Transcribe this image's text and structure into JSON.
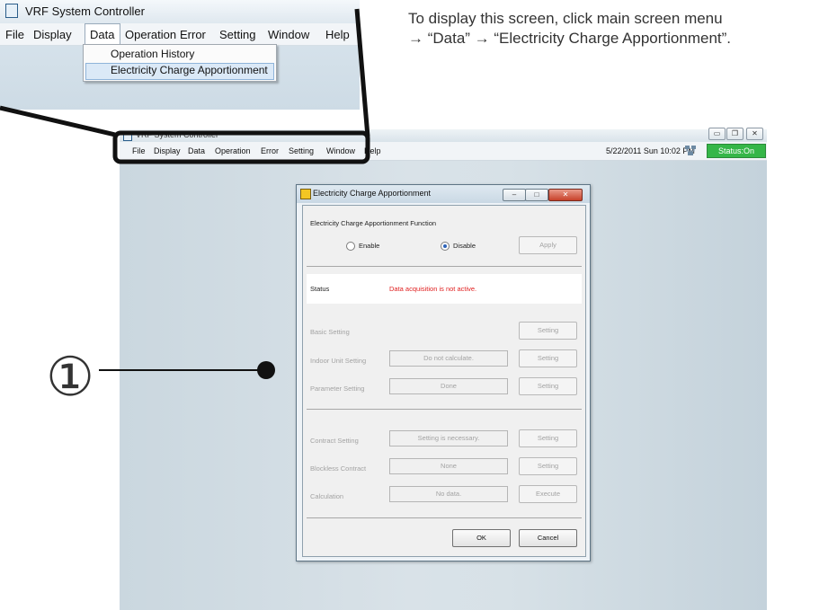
{
  "inset": {
    "title": "VRF System Controller",
    "menu": [
      "File",
      "Display",
      "Data",
      "Operation",
      "Error",
      "Setting",
      "Window",
      "Help"
    ],
    "dropdown": [
      "Operation History",
      "Electricity Charge Apportionment"
    ]
  },
  "instruction": {
    "line1": "To display this screen, click main screen menu",
    "line2": "→ “Data” → “Electricity Charge Apportionment”."
  },
  "screen": {
    "title": "VRF System Controller",
    "menu": [
      "File",
      "Display",
      "Data",
      "Operation",
      "Error",
      "Setting",
      "Window",
      "Help"
    ],
    "datetime": "5/22/2011 Sun 10:02 PM",
    "status": "Status:On",
    "status_color": "#35b648"
  },
  "dialog": {
    "title": "Electricity Charge Apportionment",
    "function_label": "Electricity Charge Apportionment Function",
    "enable": "Enable",
    "disable": "Disable",
    "apply": "Apply",
    "status_label": "Status",
    "status_value": "Data acquisition is not active.",
    "status_color": "#e02020",
    "basic_setting": "Basic Setting",
    "indoor_unit_setting": "Indoor Unit Setting",
    "indoor_unit_value": "Do not calculate.",
    "parameter_setting": "Parameter Setting",
    "parameter_value": "Done",
    "contract_setting": "Contract Setting",
    "contract_value": "Setting is necessary.",
    "blockless_contract": "Blockless Contract",
    "blockless_value": "None",
    "calculation": "Calculation",
    "calculation_value": "No data.",
    "setting_btn": "Setting",
    "execute_btn": "Execute",
    "ok": "OK",
    "cancel": "Cancel"
  },
  "callout": {
    "number": "①"
  }
}
